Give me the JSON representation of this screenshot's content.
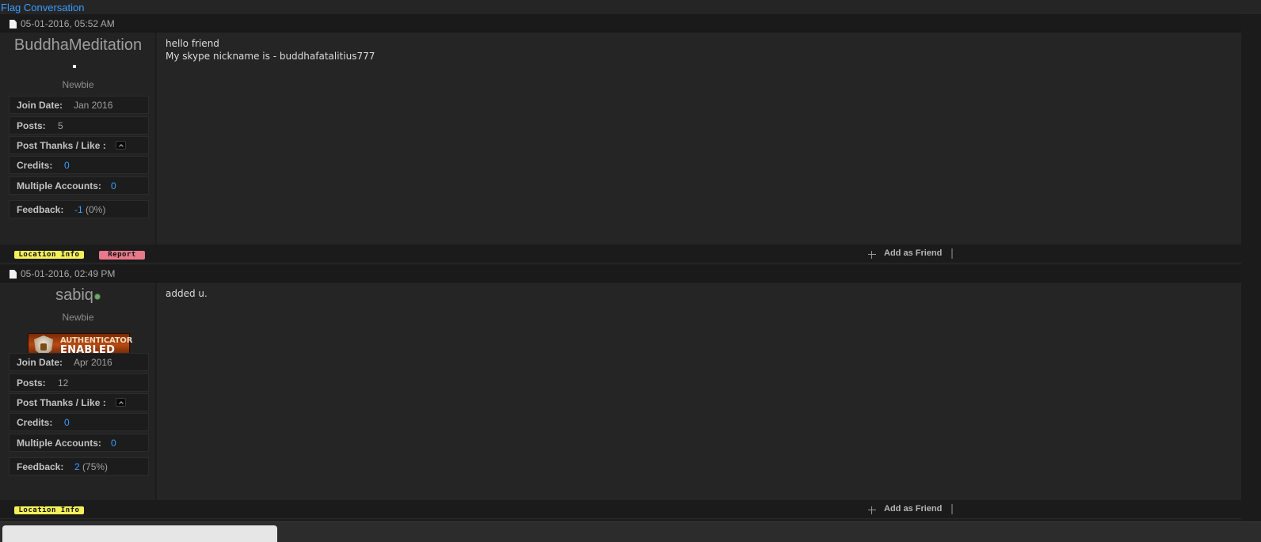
{
  "flag_link": "Flag Conversation",
  "footer": {
    "location_info": "Location Info",
    "report": "Report",
    "add_friend": "Add as Friend"
  },
  "labels": {
    "join_date": "Join Date:",
    "posts": "Posts:",
    "thanks": "Post Thanks / Like :",
    "credits": "Credits:",
    "multiple_accounts": "Multiple Accounts:",
    "feedback": "Feedback:"
  },
  "colors": {
    "link": "#3b9cff",
    "location_badge": "#f5f05a",
    "report_badge": "#e8788a",
    "online_status": "#6fa86f"
  },
  "posts": [
    {
      "date": "05-01-2016, 05:52 AM",
      "username": "BuddhaMeditation",
      "title": "Newbie",
      "join_date": "Jan 2016",
      "post_count": "5",
      "credits": "0",
      "multiple_accounts": "0",
      "feedback_value": "-1",
      "feedback_pct": "(0%)",
      "message_lines": [
        "hello friend",
        "My skype nickname is - buddhafatalitius777"
      ]
    },
    {
      "date": "05-01-2016, 02:49 PM",
      "username": "sabiq",
      "title": "Newbie",
      "badge_line1": "AUTHENTICATOR",
      "badge_line2": "ENABLED",
      "join_date": "Apr 2016",
      "post_count": "12",
      "credits": "0",
      "multiple_accounts": "0",
      "feedback_value": "2",
      "feedback_pct": "(75%)",
      "message_lines": [
        "added u."
      ]
    }
  ]
}
